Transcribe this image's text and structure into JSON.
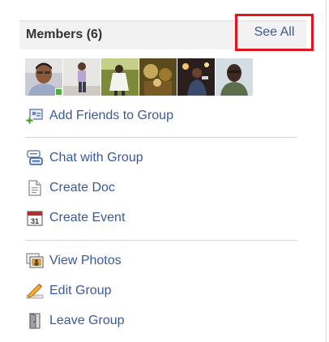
{
  "header": {
    "title": "Members (6)",
    "see_all_label": "See All"
  },
  "members": [
    {
      "icon": "member-photo-1",
      "online": true
    },
    {
      "icon": "member-photo-2",
      "online": false
    },
    {
      "icon": "member-photo-3",
      "online": false
    },
    {
      "icon": "member-photo-4",
      "online": false
    },
    {
      "icon": "member-photo-5",
      "online": false
    },
    {
      "icon": "member-photo-6",
      "online": false
    }
  ],
  "actions": {
    "add_friends": {
      "label": "Add Friends to Group",
      "icon": "add-friends-icon"
    },
    "chat": {
      "label": "Chat with Group",
      "icon": "chat-icon"
    },
    "create_doc": {
      "label": "Create Doc",
      "icon": "doc-icon"
    },
    "create_event": {
      "label": "Create Event",
      "icon": "calendar-icon",
      "calendar_day": "31"
    },
    "view_photos": {
      "label": "View Photos",
      "icon": "photos-icon"
    },
    "edit_group": {
      "label": "Edit Group",
      "icon": "edit-icon"
    },
    "leave_group": {
      "label": "Leave Group",
      "icon": "leave-icon"
    }
  },
  "colors": {
    "link": "#3b5998",
    "highlight_box": "#e0161f",
    "online": "#42b72a",
    "header_bg": "#f2f2f2"
  }
}
